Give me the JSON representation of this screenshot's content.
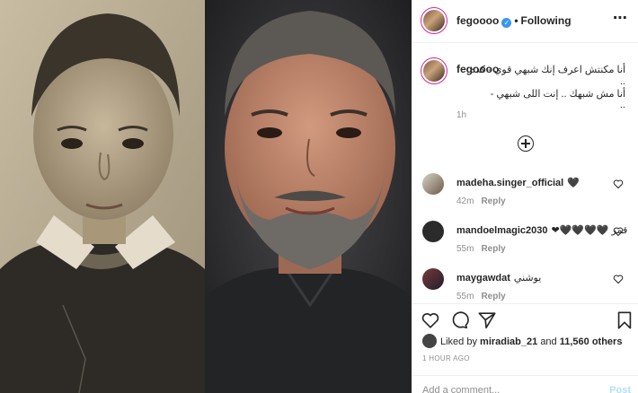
{
  "post": {
    "username": "fegoooo",
    "follow_status": "Following",
    "caption_lines": [
      "أنا مكنتش اعرف إنك شبهي قوي - كده",
      "..",
      "أنا مش شبهك .. إنت اللى شبهي -",
      ".."
    ],
    "caption_time": "1h",
    "likes_prefix": "Liked by",
    "likes_user": "miradiab_21",
    "likes_connector": "and",
    "likes_others": "11,560 others",
    "posted_ago": "1 HOUR AGO",
    "comment_placeholder": "Add a comment...",
    "post_label": "Post"
  },
  "comments": [
    {
      "user": "madeha.singer_official",
      "text": "🖤",
      "time": "42m",
      "reply": "Reply"
    },
    {
      "user": "mandoelmagic2030",
      "text": "❤🖤🖤🖤🖤 قمر",
      "time": "55m",
      "reply": "Reply"
    },
    {
      "user": "maygawdat",
      "text": "يوشني",
      "time": "55m",
      "reply": "Reply"
    }
  ],
  "icons": {
    "verified": "verified-badge-icon",
    "more": "more-options-icon",
    "load_more": "plus-circle-icon",
    "like": "heart-icon",
    "comment": "comment-bubble-icon",
    "share": "paper-plane-icon",
    "save": "bookmark-icon"
  },
  "colors": {
    "verified": "#3897f0",
    "muted": "#8e8e8e",
    "post_disabled": "#b2dffc",
    "text": "#262626"
  }
}
